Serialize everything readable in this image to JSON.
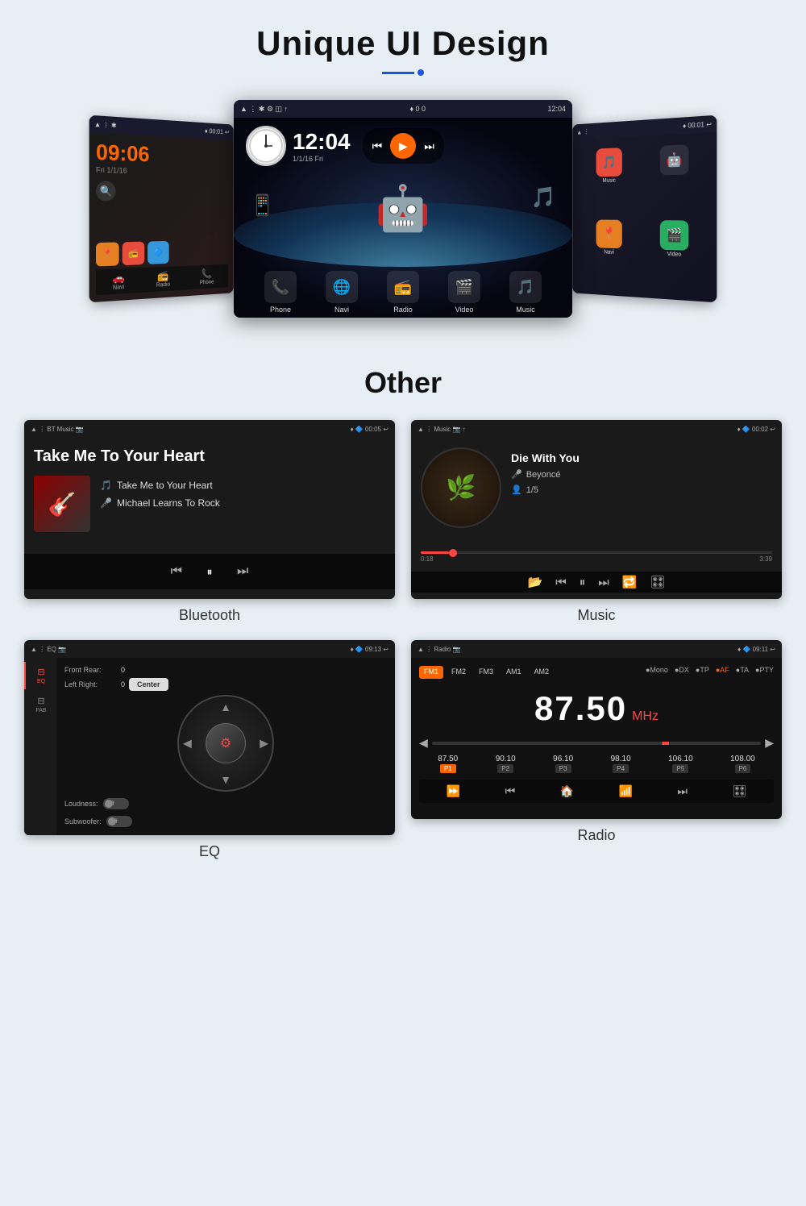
{
  "header": {
    "title": "Unique UI Design",
    "underline_text": "─ •"
  },
  "ui_design_section": {
    "left_screen": {
      "status": {
        "left": "▲  ⋮  ✱",
        "right": "♦ 0  00:01 ↩"
      },
      "time": "09:06",
      "date": "Fri 1/1/16",
      "apps": [
        "Navi",
        "Radio",
        "Phone"
      ]
    },
    "center_screen": {
      "status": {
        "left": "▲  ⋮  ✱  ⚙  ◫  ↑",
        "center": "♦ 0 0",
        "right": "12:04 ↩"
      },
      "time": "12:04",
      "date": "1/1/16 Fri",
      "apps": [
        "Phone",
        "Navi",
        "Radio",
        "Video",
        "Music"
      ]
    },
    "right_screen": {
      "status": {
        "left": "▲  ⋮",
        "right": "♦ 0  00:01 ↩"
      },
      "apps": [
        "Music",
        "Navi",
        "Video"
      ]
    }
  },
  "other_section": {
    "title": "Other"
  },
  "bluetooth_screen": {
    "status_left": "▲  ⋮  BT Music 📷",
    "status_right": "♦ 🔷  00:05 ↩",
    "title": "Take Me To Your Heart",
    "track_name": "Take Me to Your Heart",
    "artist": "Michael Learns To Rock",
    "label": "Bluetooth"
  },
  "music_screen": {
    "status_left": "▲  ⋮  Music 📷 ↑",
    "status_right": "♦ 🔷  00:02 ↩",
    "song_title": "Die With You",
    "artist": "Beyoncé",
    "track_count": "1/5",
    "time_elapsed": "0:18",
    "time_total": "3:39",
    "label": "Music"
  },
  "eq_screen": {
    "status_left": "▲  ⋮  EQ 📷",
    "status_right": "♦ 🔷  09:13 ↩",
    "front_rear_label": "Front Rear:",
    "front_rear_value": "0",
    "left_right_label": "Left Right:",
    "left_right_value": "0",
    "loudness_label": "Loudness:",
    "loudness_value": "Off",
    "subwoofer_label": "Subwoofer:",
    "subwoofer_value": "Off",
    "center_btn": "Center",
    "sidebar_items": [
      {
        "icon": "≡",
        "label": "EQ",
        "active": true
      },
      {
        "icon": "≡",
        "label": "FAB",
        "active": false
      }
    ],
    "label": "EQ"
  },
  "radio_screen": {
    "status_left": "▲  ⋮  Radio 📷",
    "status_right": "♦ 🔷  09:11 ↩",
    "tabs": [
      "FM1",
      "FM2",
      "FM3",
      "AM1",
      "AM2"
    ],
    "active_tab": "FM1",
    "options": [
      "Mono",
      "DX",
      "TP",
      "AF",
      "TA",
      "PTY"
    ],
    "frequency": "87.50",
    "unit": "MHz",
    "presets": [
      {
        "freq": "87.50",
        "num": "P1",
        "active": true
      },
      {
        "freq": "90.10",
        "num": "P2",
        "active": false
      },
      {
        "freq": "96.10",
        "num": "P3",
        "active": false
      },
      {
        "freq": "98.10",
        "num": "P4",
        "active": false
      },
      {
        "freq": "106.10",
        "num": "P5",
        "active": false
      },
      {
        "freq": "108.00",
        "num": "P6",
        "active": false
      }
    ],
    "label": "Radio"
  }
}
